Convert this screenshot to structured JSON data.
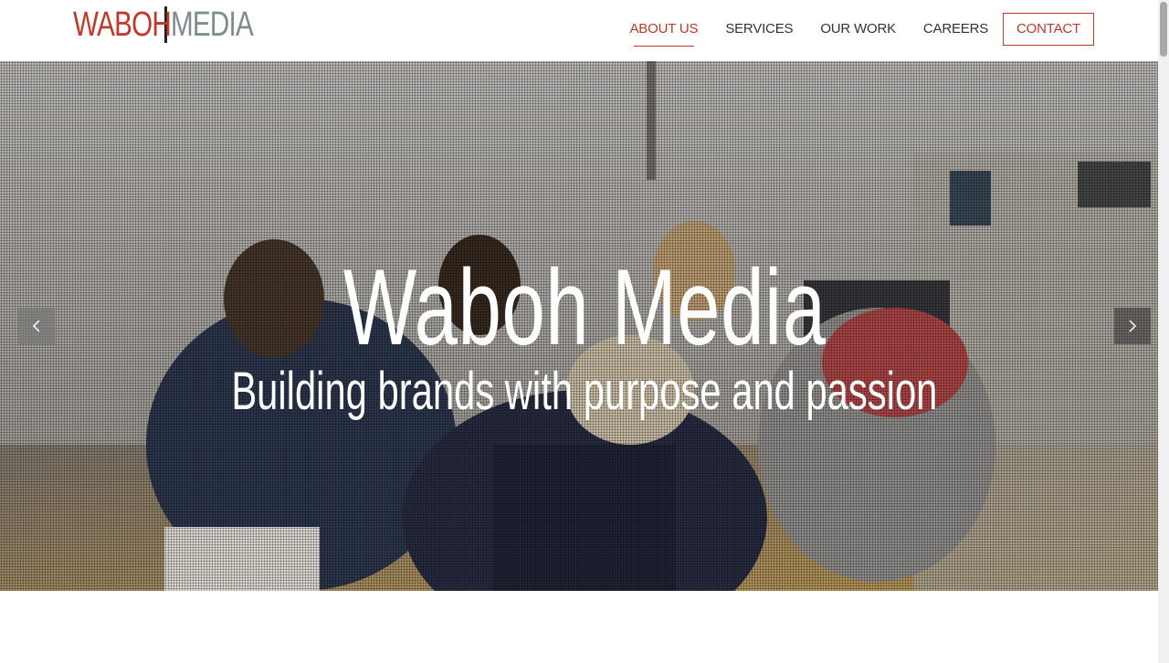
{
  "logo": {
    "left": "WABOH",
    "right": "MEDIA"
  },
  "nav": {
    "items": [
      {
        "label": "ABOUT US"
      },
      {
        "label": "SERVICES"
      },
      {
        "label": "OUR WORK"
      },
      {
        "label": "CAREERS"
      }
    ],
    "contact": "CONTACT",
    "active_index": 0
  },
  "hero": {
    "title": "Waboh Media",
    "subtitle": "Building brands with purpose and passion",
    "prev_icon": "chevron-left-icon",
    "next_icon": "chevron-right-icon"
  },
  "colors": {
    "accent": "#c0392b",
    "logo_gray": "#7f8c8d",
    "nav_text": "#333333"
  }
}
